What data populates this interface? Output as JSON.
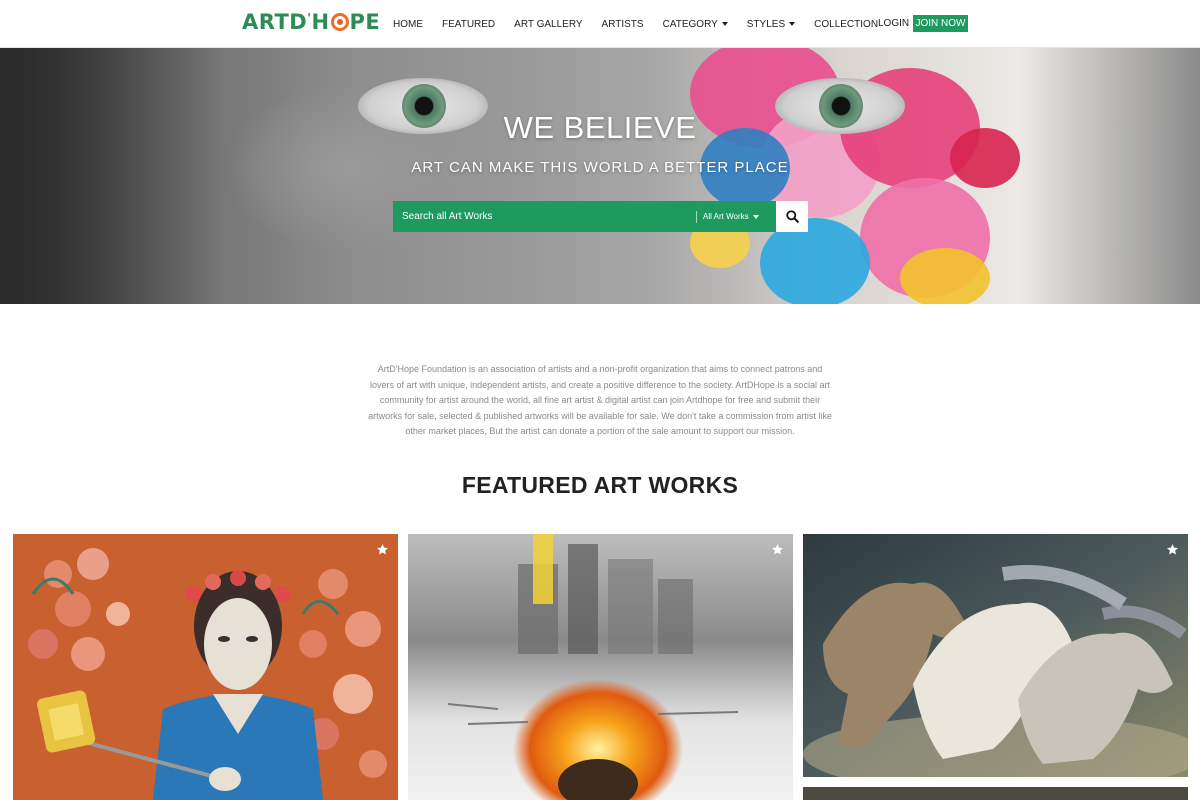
{
  "brand": {
    "name_part1": "ARTD",
    "apostrophe": "'",
    "name_part2": "H",
    "name_part3": "PE",
    "color": "#2e8b57"
  },
  "nav": {
    "items": [
      {
        "label": "HOME"
      },
      {
        "label": "FEATURED"
      },
      {
        "label": "ART GALLERY"
      },
      {
        "label": "ARTISTS"
      },
      {
        "label": "CATEGORY",
        "dropdown": true
      },
      {
        "label": "STYLES",
        "dropdown": true
      },
      {
        "label": "COLLECTION"
      }
    ],
    "login": "LOGIN",
    "join": "JOIN NOW",
    "accent": "#1f9a5f"
  },
  "hero": {
    "title": "WE BELIEVE",
    "subtitle": "ART CAN MAKE THIS WORLD A BETTER PLACE",
    "search": {
      "placeholder": "Search all Art Works",
      "category": "All Art Works",
      "button_icon": "search-icon"
    }
  },
  "about": {
    "text": "ArtD'Hope Foundation is an association of artists and a non-profit organization that aims to connect patrons and lovers of art with unique, independent artists, and create a positive difference to the society. ArtDHope is a social art community for artist around the world, all fine art artist & digital artist can join Artdhope for free and submit their artworks for sale, selected & published artworks will be available for sale. We don't take a commission from artist like other market places, But the artist can donate a portion of the sale amount to support our mission."
  },
  "featured": {
    "title": "FEATURED ART WORKS",
    "items": [
      {
        "subject": "man with flower crown taking selfie",
        "icon": "star-icon"
      },
      {
        "subject": "abstract fire and river scene",
        "icon": "star-icon"
      },
      {
        "subject": "three running horses",
        "icon": "star-icon"
      }
    ]
  }
}
